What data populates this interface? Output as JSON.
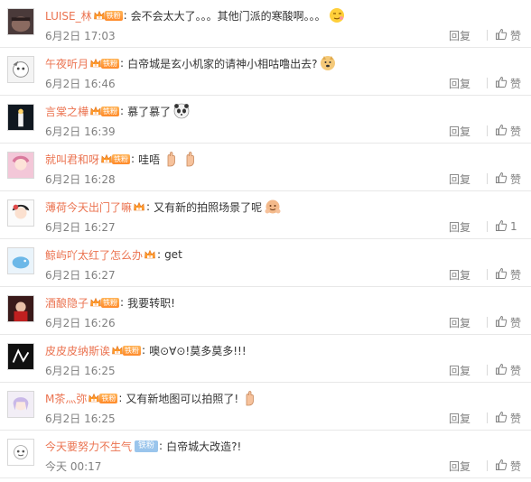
{
  "fan_badge_label": "铁粉",
  "reply_label": "回复",
  "like_label": "赞",
  "comments": [
    {
      "user": "LUISE_林",
      "badge": "gold",
      "text": "会不会太大了。。。其他门派的寒酸啊。。。",
      "emojis": [
        "smirk-emoji"
      ],
      "time": "6月2日 17:03",
      "likes": "赞"
    },
    {
      "user": "午夜听月",
      "badge": "gold",
      "text": "白帝城是玄小机家的请神小相咕噜出去?",
      "emojis": [
        "doge-emoji"
      ],
      "time": "6月2日 16:46",
      "likes": "赞"
    },
    {
      "user": "言棠之樺",
      "badge": "gold",
      "text": "慕了慕了",
      "emojis": [
        "panda-emoji"
      ],
      "time": "6月2日 16:39",
      "likes": "赞"
    },
    {
      "user": "就叫君和呀",
      "badge": "gold",
      "text": "哇唔",
      "emojis": [
        "hand-emoji",
        "hand-emoji"
      ],
      "time": "6月2日 16:28",
      "likes": "赞"
    },
    {
      "user": "薄荷今天出门了嘛",
      "badge": "crown",
      "text": "又有新的拍照场景了呢",
      "emojis": [
        "hug-emoji"
      ],
      "time": "6月2日 16:27",
      "likes": "1"
    },
    {
      "user": "鲸屿吖太红了怎么办",
      "badge": "crown",
      "text": "get",
      "emojis": [],
      "time": "6月2日 16:27",
      "likes": "赞"
    },
    {
      "user": "酒酿隐子",
      "badge": "gold",
      "text": "我要转职!",
      "emojis": [],
      "time": "6月2日 16:26",
      "likes": "赞"
    },
    {
      "user": "皮皮皮纳斯诶",
      "badge": "gold",
      "text": "噢⊙∀⊙!莫多莫多!!!",
      "emojis": [],
      "time": "6月2日 16:25",
      "likes": "赞"
    },
    {
      "user": "M茶灬弥",
      "badge": "gold",
      "text": "又有新地图可以拍照了!",
      "emojis": [
        "hand-emoji"
      ],
      "time": "6月2日 16:25",
      "likes": "赞"
    },
    {
      "user": "今天要努力不生气",
      "badge": "blue",
      "text": "白帝城大改造?!",
      "emojis": [],
      "time": "今天 00:17",
      "likes": "赞"
    }
  ],
  "colors": {
    "username": "#eb7350",
    "text": "#333333",
    "meta": "#808080",
    "badge": "#ff9a3c"
  }
}
